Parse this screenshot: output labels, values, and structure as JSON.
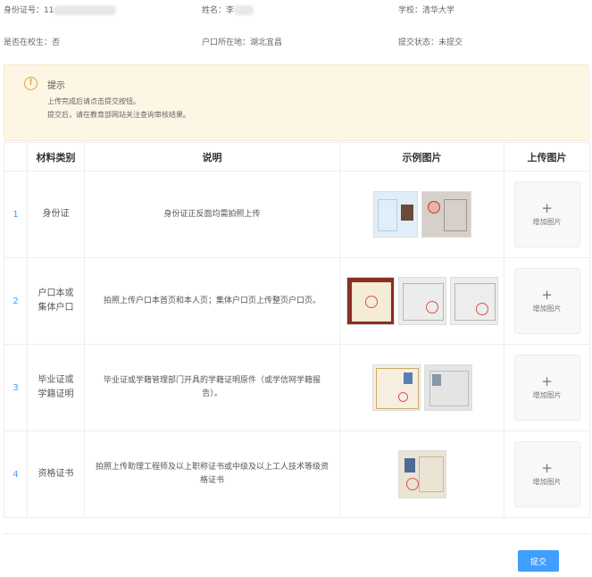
{
  "info": {
    "id_label": "身份证号：11",
    "name_label": "姓名：李",
    "school": "学校：清华大学",
    "in_school": "是否在校生：否",
    "hukou": "户口所在地：湖北宜昌",
    "status": "提交状态：未提交"
  },
  "notice": {
    "icon": "info-icon",
    "title": "提示",
    "line1": "上传完成后请点击提交按钮。",
    "line2": "提交后，请在教育部网站关注查询审核结果。",
    "accent_color": "#e6a23c",
    "background": "#fdf6e4"
  },
  "table": {
    "headers": [
      "",
      "材料类别",
      "说明",
      "示例图片",
      "上传图片"
    ],
    "rows": [
      {
        "index": "1",
        "category": "身份证",
        "description": "身份证正反面均需拍照上传",
        "upload_label": "增加图片",
        "samples": [
          "id-card-front",
          "id-card-back"
        ]
      },
      {
        "index": "2",
        "category": "户口本或集体户口",
        "description": "拍照上传户口本首页和本人页；集体户口页上传整页户口页。",
        "upload_label": "增加图片",
        "samples": [
          "hukou-cover",
          "hukou-page",
          "hukou-personal"
        ]
      },
      {
        "index": "3",
        "category": "毕业证或学籍证明",
        "description": "毕业证或学籍管理部门开具的学籍证明原件（或学信网学籍报告）。",
        "upload_label": "增加图片",
        "samples": [
          "diploma",
          "student-certificate"
        ]
      },
      {
        "index": "4",
        "category": "资格证书",
        "description": "拍照上传助理工程师及以上职称证书或中级及以上工人技术等级资格证书",
        "upload_label": "增加图片",
        "samples": [
          "qualification-certificate"
        ]
      }
    ]
  },
  "submit_label": "提交",
  "accent": "#409eff"
}
